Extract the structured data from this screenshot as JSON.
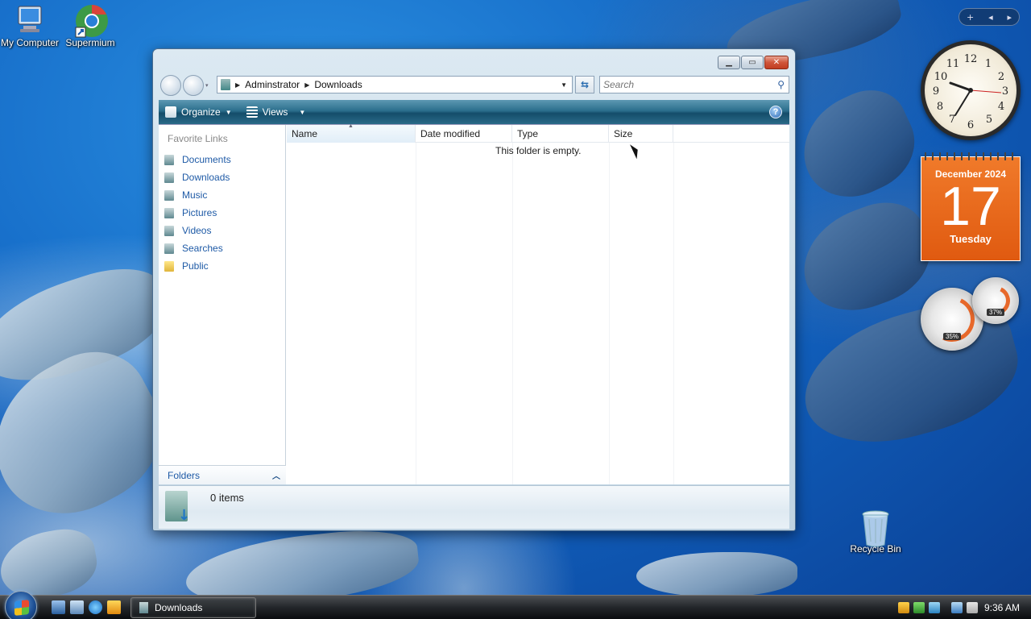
{
  "desktop": {
    "icons": [
      {
        "label": "My Computer"
      },
      {
        "label": "Supermium"
      },
      {
        "label": "Recycle Bin"
      }
    ]
  },
  "window": {
    "address": {
      "crumbs": [
        "Adminstrator",
        "Downloads"
      ]
    },
    "search": {
      "placeholder": "Search"
    },
    "toolbar": {
      "organize_label": "Organize",
      "views_label": "Views",
      "help_label": "?"
    },
    "nav_pane": {
      "title": "Favorite Links",
      "items": [
        {
          "label": "Documents"
        },
        {
          "label": "Downloads"
        },
        {
          "label": "Music"
        },
        {
          "label": "Pictures"
        },
        {
          "label": "Videos"
        },
        {
          "label": "Searches"
        },
        {
          "label": "Public"
        }
      ],
      "folders_label": "Folders"
    },
    "columns": {
      "name": "Name",
      "date_modified": "Date modified",
      "type": "Type",
      "size": "Size"
    },
    "empty_message": "This folder is empty.",
    "details": {
      "item_count": "0 items"
    }
  },
  "gadgets": {
    "calendar": {
      "month_year": "December 2024",
      "day": "17",
      "weekday": "Tuesday"
    },
    "cpu_meter": {
      "cpu": "35%",
      "memory": "37%"
    }
  },
  "taskbar": {
    "task_label": "Downloads",
    "clock": "9:36 AM"
  },
  "colors": {
    "toolbar": "#2b6e8c",
    "link": "#1e5aa6",
    "calendar": "#e86a1a"
  }
}
